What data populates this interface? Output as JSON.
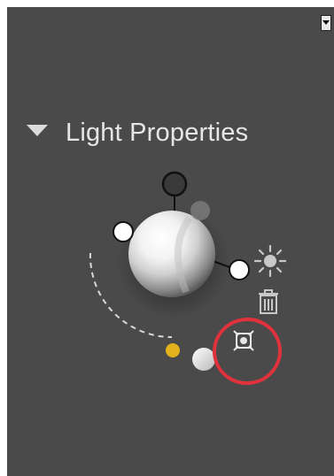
{
  "panel": {
    "menu_icon": "panel-menu-dropdown-icon",
    "section_title": "Light Properties",
    "section_toggle_icon": "collapse-triangle-icon"
  },
  "light_widget": {
    "icons": {
      "sphere": "light-preview-sphere-icon",
      "add_light": "sun-icon",
      "delete_light": "trash-icon",
      "focus_light": "target-center-icon"
    },
    "colors": {
      "panel_bg": "#4a4a4a",
      "highlight_ring": "#e0323c",
      "ambient_handle": "#e2b21d"
    }
  }
}
